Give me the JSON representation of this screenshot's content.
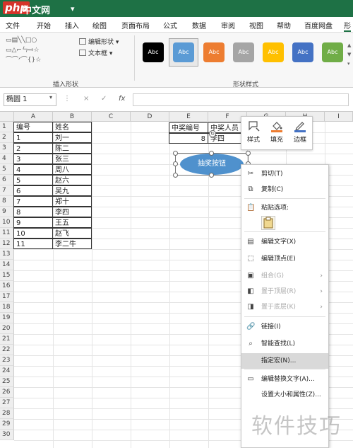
{
  "brand": {
    "logo": "php",
    "site": "中文网"
  },
  "title_bar": {
    "glyphs": [
      "⊟",
      "⊡",
      "⊟",
      "▾"
    ]
  },
  "menu": {
    "tabs": [
      "文件",
      "开始",
      "插入",
      "绘图",
      "页面布局",
      "公式",
      "数据",
      "审阅",
      "视图",
      "帮助",
      "百度网盘",
      "形"
    ],
    "active_index": 11
  },
  "ribbon": {
    "edit_shape": "编辑形状",
    "text_box": "文本框",
    "group_insert_shapes": "插入形状",
    "group_shape_styles": "形状样式",
    "swatches": [
      {
        "label": "Abc",
        "color": "#000000"
      },
      {
        "label": "Abc",
        "color": "#5b9bd5"
      },
      {
        "label": "Abc",
        "color": "#ed7d31"
      },
      {
        "label": "Abc",
        "color": "#a5a5a5"
      },
      {
        "label": "Abc",
        "color": "#ffc000"
      },
      {
        "label": "Abc",
        "color": "#4472c4"
      },
      {
        "label": "Abc",
        "color": "#70ad47"
      }
    ]
  },
  "formula_bar": {
    "name_box": "椭圆 1",
    "cancel": "×",
    "confirm": "✓",
    "fx": "fx",
    "content": ""
  },
  "sheet": {
    "columns": [
      "A",
      "B",
      "C",
      "D",
      "E",
      "F",
      "G",
      "H",
      "I"
    ],
    "rows": [
      "1",
      "2",
      "3",
      "4",
      "5",
      "6",
      "7",
      "8",
      "9",
      "10",
      "11",
      "12",
      "13",
      "14",
      "15",
      "16",
      "17",
      "18",
      "19",
      "20",
      "21",
      "22",
      "23",
      "24",
      "25",
      "26",
      "27",
      "28",
      "29",
      "30"
    ],
    "table_ab": [
      [
        "编号",
        "姓名"
      ],
      [
        "1",
        "刘一"
      ],
      [
        "2",
        "陈二"
      ],
      [
        "3",
        "张三"
      ],
      [
        "4",
        "周八"
      ],
      [
        "5",
        "赵六"
      ],
      [
        "6",
        "吴九"
      ],
      [
        "7",
        "郑十"
      ],
      [
        "8",
        "李四"
      ],
      [
        "9",
        "王五"
      ],
      [
        "10",
        "赵飞"
      ],
      [
        "11",
        "李二牛"
      ]
    ],
    "table_ef": {
      "header_e": "中奖编号",
      "header_f": "中奖人员",
      "value_e": "8",
      "value_f": "李四"
    }
  },
  "shape": {
    "label": "抽奖按钮"
  },
  "mini_toolbar": {
    "style": "样式",
    "fill": "填充",
    "outline": "边框"
  },
  "context_menu": {
    "items": [
      {
        "label": "剪切(T)",
        "icon": "scissors-icon",
        "glyph": "✂",
        "disabled": false,
        "submenu": false
      },
      {
        "label": "复制(C)",
        "icon": "copy-icon",
        "glyph": "⧉",
        "disabled": false,
        "submenu": false
      },
      {
        "label": "粘贴选项:",
        "icon": "paste-icon",
        "glyph": "📋",
        "disabled": false,
        "submenu": false
      },
      {
        "label": "编辑文字(X)",
        "icon": "edit-text-icon",
        "glyph": "▤",
        "disabled": false,
        "submenu": false
      },
      {
        "label": "编辑顶点(E)",
        "icon": "edit-points-icon",
        "glyph": "⬚",
        "disabled": false,
        "submenu": false
      },
      {
        "label": "组合(G)",
        "icon": "group-icon",
        "glyph": "▣",
        "disabled": true,
        "submenu": true
      },
      {
        "label": "置于顶层(R)",
        "icon": "bring-front-icon",
        "glyph": "◧",
        "disabled": true,
        "submenu": true
      },
      {
        "label": "置于底层(K)",
        "icon": "send-back-icon",
        "glyph": "◨",
        "disabled": true,
        "submenu": true
      },
      {
        "label": "链接(I)",
        "icon": "link-icon",
        "glyph": "🔗",
        "disabled": false,
        "submenu": false
      },
      {
        "label": "智能查找(L)",
        "icon": "smart-lookup-icon",
        "glyph": "⌕",
        "disabled": false,
        "submenu": false
      },
      {
        "label": "指定宏(N)...",
        "icon": "",
        "glyph": "",
        "disabled": false,
        "submenu": false,
        "hover": true
      },
      {
        "label": "编辑替换文字(A)...",
        "icon": "alt-text-icon",
        "glyph": "▭",
        "disabled": false,
        "submenu": false
      },
      {
        "label": "设置大小和属性(Z)...",
        "icon": "",
        "glyph": "",
        "disabled": false,
        "submenu": false
      }
    ]
  },
  "watermark": "软件技巧"
}
